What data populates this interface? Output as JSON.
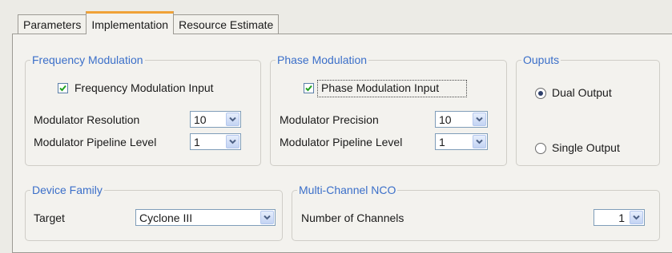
{
  "tabs": [
    {
      "label": "Parameters"
    },
    {
      "label": "Implementation"
    },
    {
      "label": "Resource Estimate"
    }
  ],
  "frequency_modulation": {
    "title": "Frequency Modulation",
    "input_checkbox_label": "Frequency Modulation Input",
    "input_checked": true,
    "resolution_label": "Modulator Resolution",
    "resolution_value": "10",
    "pipeline_label": "Modulator Pipeline Level",
    "pipeline_value": "1"
  },
  "phase_modulation": {
    "title": "Phase Modulation",
    "input_checkbox_label": "Phase Modulation Input",
    "input_checked": true,
    "precision_label": "Modulator Precision",
    "precision_value": "10",
    "pipeline_label": "Modulator Pipeline Level",
    "pipeline_value": "1"
  },
  "outputs": {
    "title": "Ouputs",
    "dual_label": "Dual Output",
    "single_label": "Single Output",
    "selected": "dual"
  },
  "device_family": {
    "title": "Device Family",
    "target_label": "Target",
    "target_value": "Cyclone III"
  },
  "multi_channel": {
    "title": "Multi-Channel NCO",
    "channels_label": "Number of Channels",
    "channels_value": "1"
  },
  "colors": {
    "group_title": "#3b6fc9",
    "active_tab_accent": "#f0a238"
  }
}
